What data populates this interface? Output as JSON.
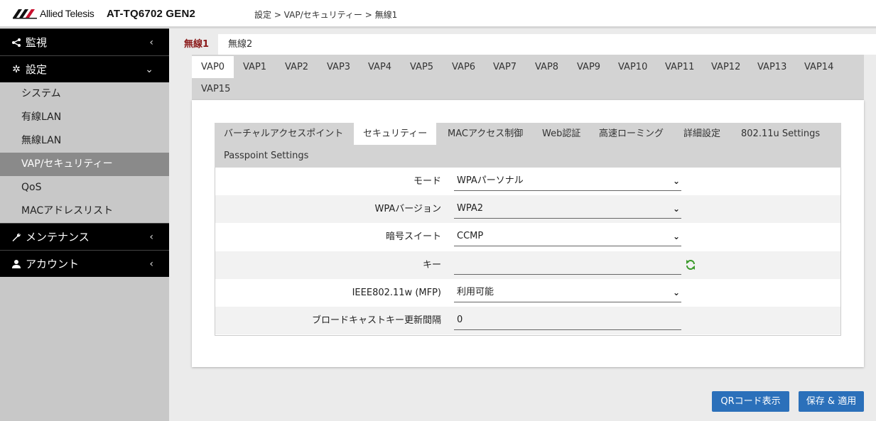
{
  "header": {
    "brand": "Allied Telesis",
    "model": "AT-TQ6702 GEN2",
    "breadcrumb": "設定 > VAP/セキュリティー > 無線1"
  },
  "sidebar": {
    "groups": [
      {
        "label": "監視",
        "icon": "share-icon",
        "state": "collapsed"
      },
      {
        "label": "設定",
        "icon": "gear-icon",
        "state": "expanded"
      },
      {
        "label": "メンテナンス",
        "icon": "wrench-icon",
        "state": "collapsed"
      },
      {
        "label": "アカウント",
        "icon": "user-icon",
        "state": "collapsed"
      }
    ],
    "settings_items": [
      "システム",
      "有線LAN",
      "無線LAN",
      "VAP/セキュリティー",
      "QoS",
      "MACアドレスリスト"
    ],
    "active_item": "VAP/セキュリティー"
  },
  "radio_tabs": [
    "無線1",
    "無線2"
  ],
  "vap_tabs": [
    "VAP0",
    "VAP1",
    "VAP2",
    "VAP3",
    "VAP4",
    "VAP5",
    "VAP6",
    "VAP7",
    "VAP8",
    "VAP9",
    "VAP10",
    "VAP11",
    "VAP12",
    "VAP13",
    "VAP14",
    "VAP15"
  ],
  "sub_tabs": [
    "バーチャルアクセスポイント",
    "セキュリティー",
    "MACアクセス制御",
    "Web認証",
    "高速ローミング",
    "詳細設定",
    "802.11u Settings",
    "Passpoint Settings"
  ],
  "form": {
    "mode": {
      "label": "モード",
      "value": "WPAパーソナル"
    },
    "wpa_version": {
      "label": "WPAバージョン",
      "value": "WPA2"
    },
    "cipher": {
      "label": "暗号スイート",
      "value": "CCMP"
    },
    "key": {
      "label": "キー",
      "value": ""
    },
    "mfp": {
      "label": "IEEE802.11w (MFP)",
      "value": "利用可能"
    },
    "broadcast_key_interval": {
      "label": "ブロードキャストキー更新間隔",
      "value": "0"
    }
  },
  "buttons": {
    "qr": "QRコード表示",
    "save": "保存 & 適用"
  },
  "colors": {
    "accent": "#2b70ba",
    "active_radio_tab": "#8b1a1a",
    "sidebar_dark": "#000000",
    "refresh_icon": "#3a9a2a"
  }
}
